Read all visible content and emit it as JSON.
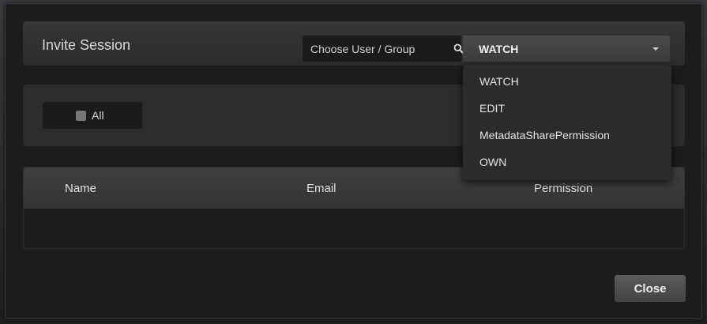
{
  "dialog": {
    "title": "Invite Session",
    "search": {
      "placeholder": "Choose User / Group",
      "value": ""
    },
    "permission_select": {
      "selected": "WATCH",
      "options": [
        "WATCH",
        "EDIT",
        "MetadataSharePermission",
        "OWN"
      ]
    },
    "filter": {
      "all_label": "All",
      "all_checked": false
    },
    "table": {
      "columns": [
        "Name",
        "Email",
        "Permission"
      ],
      "rows": []
    },
    "close_label": "Close"
  },
  "colors": {
    "dialog_bg": "#1c1c1c",
    "panel_bg": "#2c2c2c",
    "text": "#d8d8d8"
  }
}
